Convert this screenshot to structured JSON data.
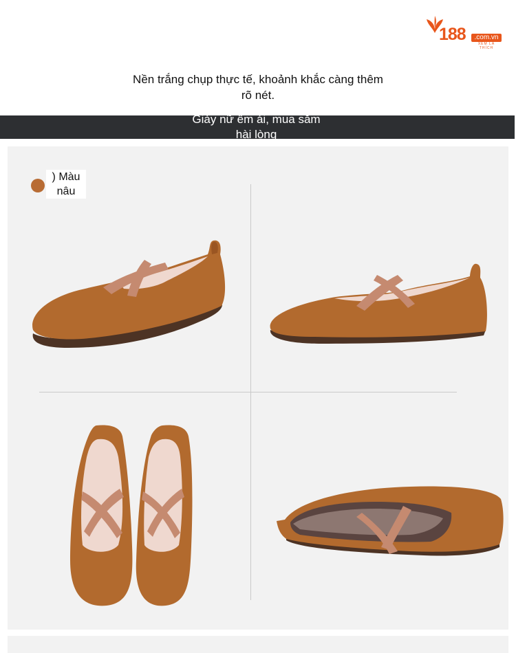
{
  "brand": {
    "number": "188",
    "domain": ".com.vn",
    "tagline": "XEM LÀ THÍCH",
    "color": "#e8561b"
  },
  "caption": {
    "line1": "Nền trắng chụp thực tế, khoảnh khắc càng thêm",
    "line2": "rõ nét."
  },
  "banner": {
    "line1": "Giày nữ êm ái, mua sắm",
    "line2": "hài lòng"
  },
  "color_option": {
    "line1": ") Màu",
    "line2": "nâu",
    "swatch": "#b86c34"
  },
  "product_views": [
    "side-view-left",
    "side-view-right",
    "top-view-pair",
    "low-angle-view"
  ],
  "colors": {
    "suede": "#b26a2e",
    "strap": "#c58a70",
    "insole": "#efd8cf",
    "sole": "#4d3324",
    "banner": "#2d2f32"
  }
}
